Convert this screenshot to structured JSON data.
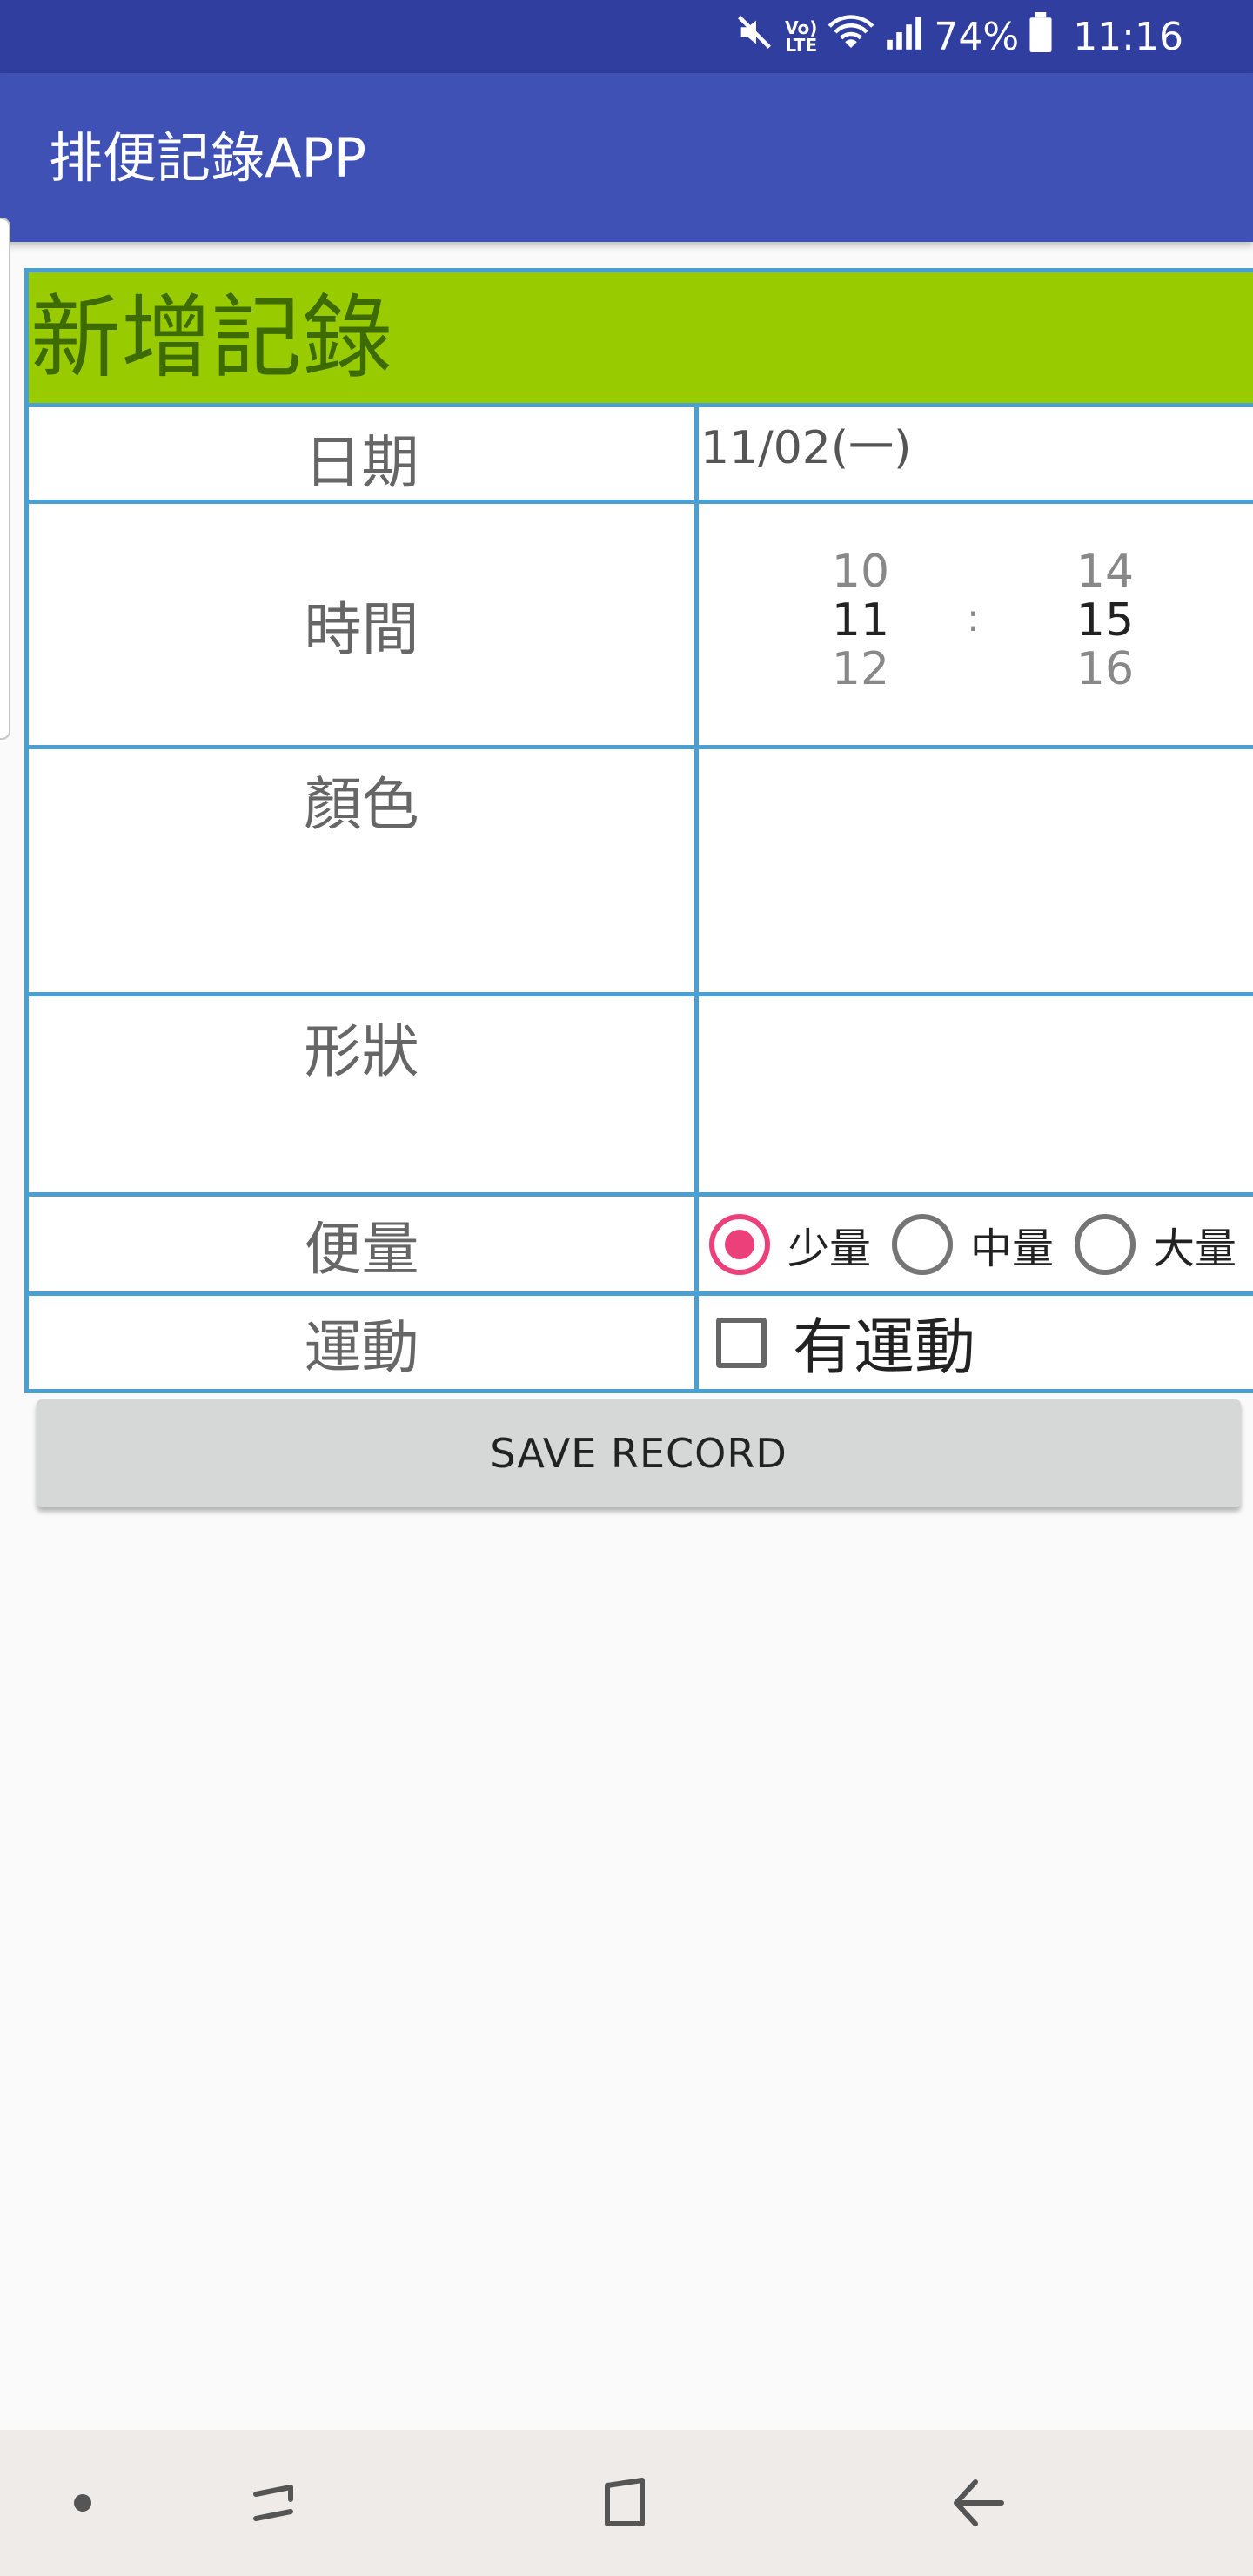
{
  "status_bar": {
    "battery": "74%",
    "time": "11:16",
    "icons": [
      "mute-icon",
      "volte-icon",
      "wifi-icon",
      "signal-icon",
      "battery-icon"
    ],
    "volte_label": "Vo)\nLTE"
  },
  "app_bar": {
    "title": "排便記錄APP"
  },
  "form": {
    "header": "新增記錄",
    "date_label": "日期",
    "date_value": "11/02(一)",
    "time_label": "時間",
    "hour_options": [
      "10",
      "11",
      "12"
    ],
    "minute_options": [
      "14",
      "15",
      "16"
    ],
    "time_separator": ":",
    "color_label": "顏色",
    "shape_label": "形狀",
    "amount_label": "便量",
    "amount_options": [
      {
        "label": "少量",
        "checked": true
      },
      {
        "label": "中量",
        "checked": false
      },
      {
        "label": "大量",
        "checked": false
      }
    ],
    "exercise_label": "運動",
    "exercise_checkbox_label": "有運動",
    "exercise_checked": false
  },
  "save_button": {
    "label": "SAVE RECORD"
  },
  "nav_bar": {
    "icons": [
      "dot-icon",
      "recents-icon",
      "home-icon",
      "back-icon"
    ]
  },
  "colors": {
    "status_bar": "#303f9f",
    "app_bar": "#3f51b5",
    "header_bg": "#99cc00",
    "table_border": "#4b9fd1",
    "radio_accent": "#ec407a"
  }
}
